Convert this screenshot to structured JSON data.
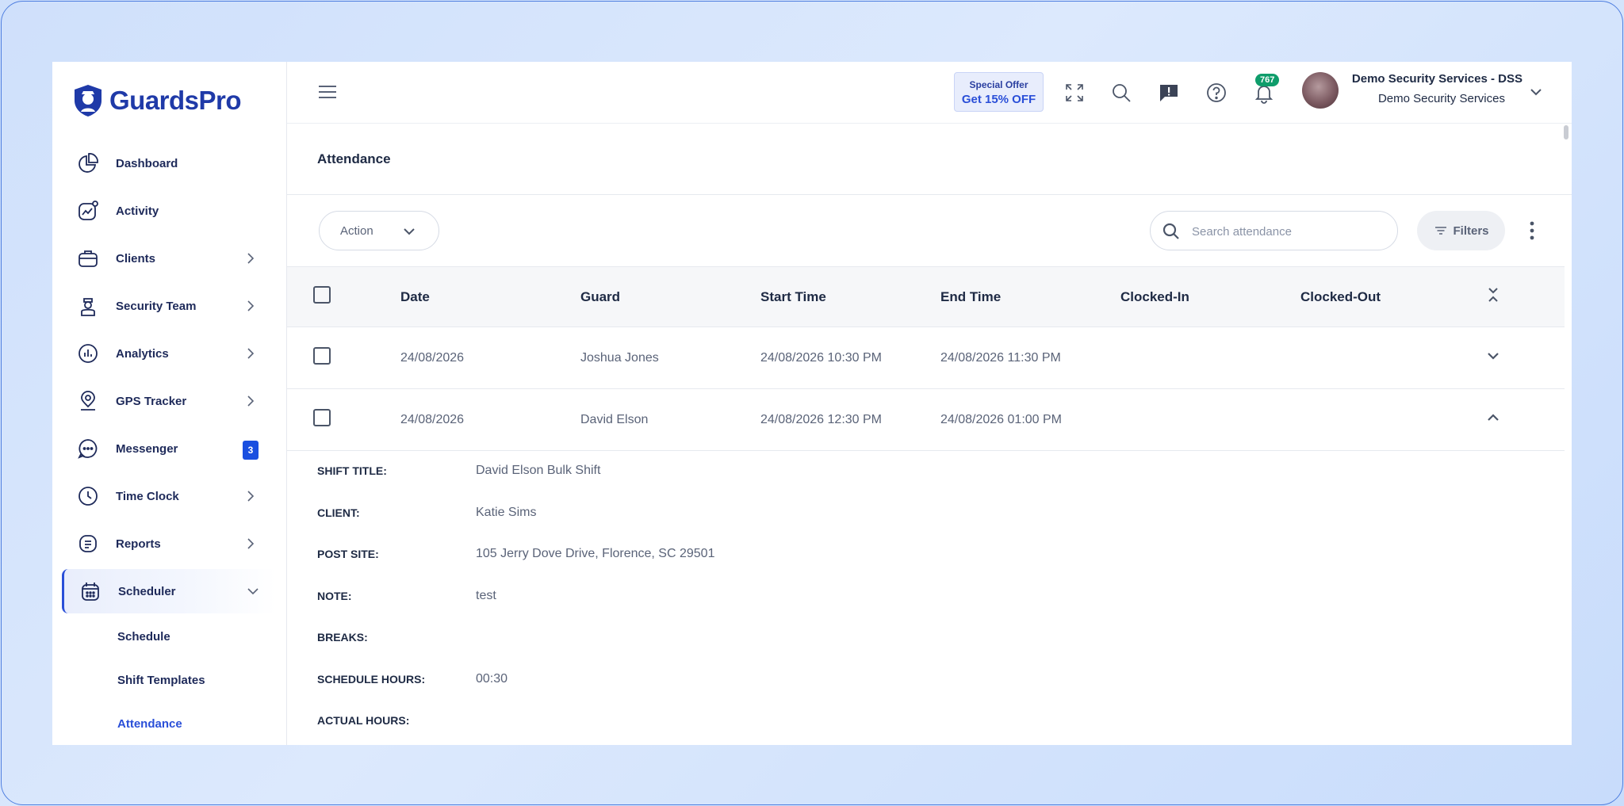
{
  "brand": {
    "name": "GuardsPro"
  },
  "sidebar": {
    "items": [
      {
        "label": "Dashboard"
      },
      {
        "label": "Activity"
      },
      {
        "label": "Clients"
      },
      {
        "label": "Security Team"
      },
      {
        "label": "Analytics"
      },
      {
        "label": "GPS Tracker"
      },
      {
        "label": "Messenger",
        "badge": "3"
      },
      {
        "label": "Time Clock"
      },
      {
        "label": "Reports"
      },
      {
        "label": "Scheduler"
      }
    ],
    "scheduler_sub": [
      {
        "label": "Schedule"
      },
      {
        "label": "Shift Templates"
      },
      {
        "label": "Attendance"
      }
    ]
  },
  "topbar": {
    "offer_line1": "Special Offer",
    "offer_line2": "Get 15% OFF",
    "notification_count": "767",
    "account_name": "Demo Security Services - DSS",
    "account_company": "Demo Security Services"
  },
  "page": {
    "title": "Attendance"
  },
  "toolbar": {
    "action_label": "Action",
    "search_placeholder": "Search attendance",
    "filters_label": "Filters"
  },
  "table": {
    "headers": [
      "Date",
      "Guard",
      "Start Time",
      "End Time",
      "Clocked-In",
      "Clocked-Out"
    ],
    "rows": [
      {
        "date": "24/08/2026",
        "guard": "Joshua Jones",
        "start": "24/08/2026 10:30 PM",
        "end": "24/08/2026 11:30 PM",
        "clocked_in": "",
        "clocked_out": "",
        "expanded": false
      },
      {
        "date": "24/08/2026",
        "guard": "David Elson",
        "start": "24/08/2026 12:30 PM",
        "end": "24/08/2026 01:00 PM",
        "clocked_in": "",
        "clocked_out": "",
        "expanded": true
      }
    ]
  },
  "details": {
    "shift_title_label": "SHIFT TITLE:",
    "shift_title": "David Elson Bulk Shift",
    "client_label": "CLIENT:",
    "client": "Katie Sims",
    "post_site_label": "POST SITE:",
    "post_site": "105 Jerry Dove Drive, Florence, SC 29501",
    "note_label": "NOTE:",
    "note": "test",
    "breaks_label": "BREAKS:",
    "breaks": "",
    "schedule_hours_label": "SCHEDULE HOURS:",
    "schedule_hours": "00:30",
    "actual_hours_label": "ACTUAL HOURS:",
    "actual_hours": ""
  },
  "colors": {
    "accent": "#2a4fd8",
    "brand": "#1f3aa8",
    "badge_green": "#0f9d6b"
  }
}
